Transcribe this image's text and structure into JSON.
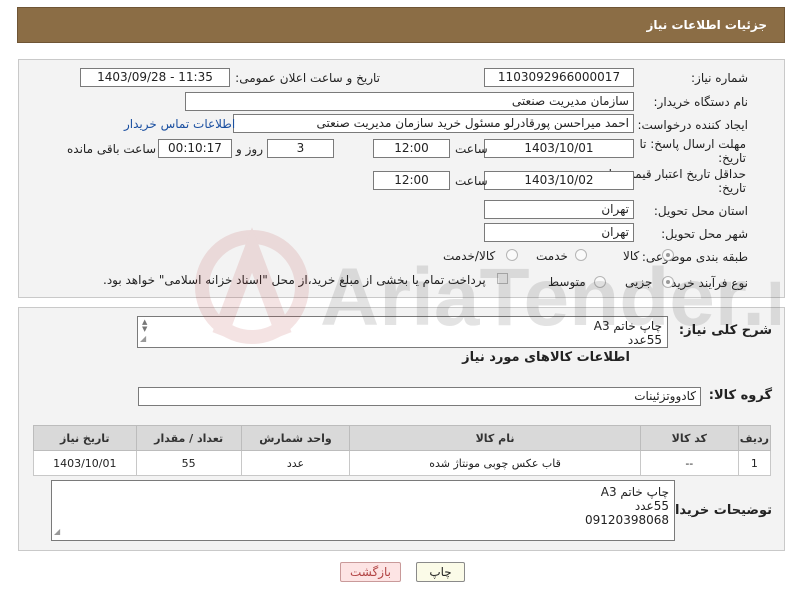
{
  "header": {
    "title": "جزئیات اطلاعات نیاز"
  },
  "form": {
    "need_number_label": "شماره نیاز:",
    "need_number": "1103092966000017",
    "announce_label": "تاریخ و ساعت اعلان عمومی:",
    "announce_value": "1403/09/28 - 11:35",
    "buyer_org_label": "نام دستگاه خریدار:",
    "buyer_org": "سازمان مدیریت صنعتی",
    "creator_label": "ایجاد کننده درخواست:",
    "creator": "احمد میراحسن پورقادرلو مسئول خرید سازمان مدیریت صنعتی",
    "contact_link": "اطلاعات تماس خریدار",
    "reply_deadline_label_1": "مهلت ارسال پاسخ: تا",
    "reply_deadline_label_2": "تاریخ:",
    "reply_date": "1403/10/01",
    "time_label": "ساعت",
    "reply_time": "12:00",
    "days": "3",
    "days_label": "روز و",
    "remaining": "00:10:17",
    "remaining_label": "ساعت باقی مانده",
    "price_deadline_label_1": "حداقل تاریخ اعتبار قیمت: تا",
    "price_deadline_label_2": "تاریخ:",
    "price_date": "1403/10/02",
    "price_time": "12:00",
    "province_label": "استان محل تحویل:",
    "province": "تهران",
    "city_label": "شهر محل تحویل:",
    "city": "تهران",
    "category_label": "طبقه بندی موضوعی:",
    "category_options": [
      "کالا",
      "خدمت",
      "کالا/خدمت"
    ],
    "process_label": "نوع فرآیند خرید :",
    "process_options": [
      "جزیی",
      "متوسط"
    ],
    "payment_note": "پرداخت تمام یا بخشی از مبلغ خرید،از محل \"اسناد خزانه اسلامی\" خواهد بود."
  },
  "description": {
    "label": "شرح کلی نیاز:",
    "lines": [
      "چاپ خاتم A3",
      "55عدد"
    ]
  },
  "goods": {
    "section_title": "اطلاعات کالاهای مورد نیاز",
    "group_label": "گروه کالا:",
    "group_value": "کادووتزئینات"
  },
  "table": {
    "headers": [
      "ردیف",
      "کد کالا",
      "نام کالا",
      "واحد شمارش",
      "تعداد / مقدار",
      "تاریخ نیاز"
    ],
    "rows": [
      [
        "1",
        "--",
        "قاب عکس چوبی مونتاژ شده",
        "عدد",
        "55",
        "1403/10/01"
      ]
    ]
  },
  "buyer_notes": {
    "label": "توضیحات خریدار:",
    "lines": [
      "چاپ خاتم A3",
      "55عدد",
      "09120398068"
    ]
  },
  "buttons": {
    "print": "چاپ",
    "back": "بازگشت"
  },
  "watermark": {
    "text": "AriaTender.neT"
  }
}
